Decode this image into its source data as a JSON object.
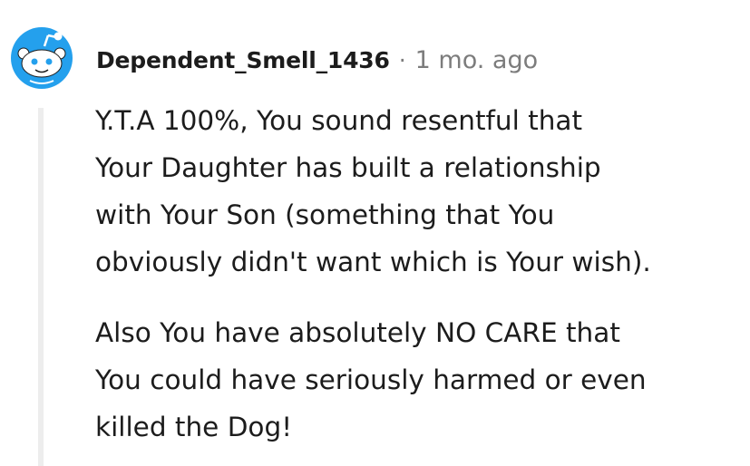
{
  "comment": {
    "author": "Dependent_Smell_1436",
    "separator": "·",
    "timestamp": "1 mo. ago",
    "avatar_icon": "snoo-avatar-icon",
    "paragraphs": [
      {
        "lines": [
          "Y.T.A 100%, You sound resentful that",
          "Your Daughter has built a relationship",
          "with Your Son (something that You",
          "obviously didn't want which is Your wish)."
        ]
      },
      {
        "lines": [
          "Also You have absolutely NO CARE that",
          "You could have seriously harmed or even",
          "killed the Dog!"
        ]
      }
    ]
  },
  "colors": {
    "avatar_bg": "#24a0ed",
    "text": "#1c1c1c",
    "meta": "#7c7c7c",
    "thread_line": "#ededed"
  }
}
